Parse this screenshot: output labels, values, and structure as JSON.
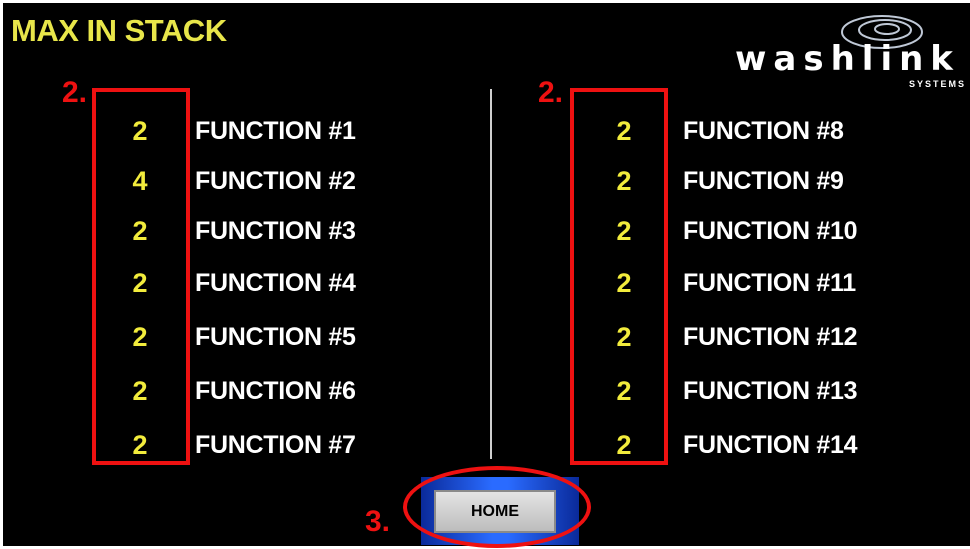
{
  "title": "MAX IN STACK",
  "logo": {
    "word": "washlink",
    "sub": "SYSTEMS"
  },
  "left_column": [
    {
      "value": "2",
      "label": "FUNCTION #1"
    },
    {
      "value": "4",
      "label": "FUNCTION #2"
    },
    {
      "value": "2",
      "label": "FUNCTION #3"
    },
    {
      "value": "2",
      "label": "FUNCTION #4"
    },
    {
      "value": "2",
      "label": "FUNCTION #5"
    },
    {
      "value": "2",
      "label": "FUNCTION #6"
    },
    {
      "value": "2",
      "label": "FUNCTION #7"
    }
  ],
  "right_column": [
    {
      "value": "2",
      "label": "FUNCTION #8"
    },
    {
      "value": "2",
      "label": "FUNCTION #9"
    },
    {
      "value": "2",
      "label": "FUNCTION #10"
    },
    {
      "value": "2",
      "label": "FUNCTION #11"
    },
    {
      "value": "2",
      "label": "FUNCTION #12"
    },
    {
      "value": "2",
      "label": "FUNCTION #13"
    },
    {
      "value": "2",
      "label": "FUNCTION #14"
    }
  ],
  "home_button": "HOME",
  "annotations": {
    "left_marker": "2.",
    "right_marker": "2.",
    "home_marker": "3."
  },
  "colors": {
    "background": "#000000",
    "title": "#e8e64a",
    "value": "#f2ec3c",
    "label": "#ffffff",
    "annotation": "#e11111",
    "button_frame": "#2a6bff"
  }
}
